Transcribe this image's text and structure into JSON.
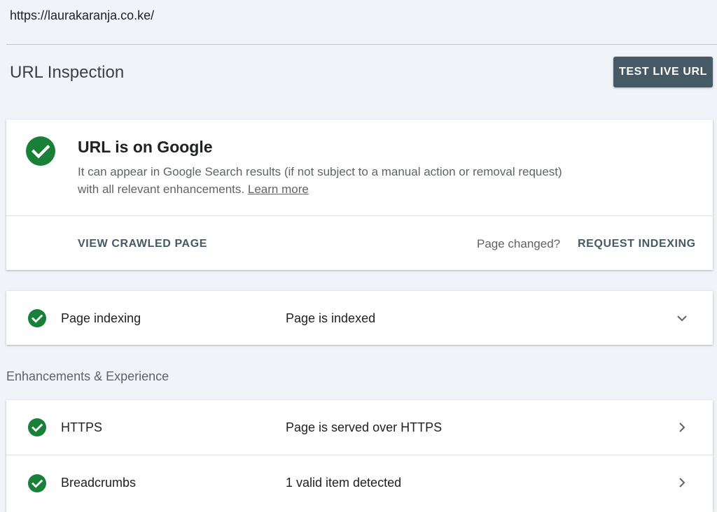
{
  "browser": {
    "url": "https://laurakaranja.co.ke/"
  },
  "header": {
    "title": "URL Inspection",
    "test_live_url_label": "TEST LIVE URL"
  },
  "status": {
    "title": "URL is on Google",
    "description": "It can appear in Google Search results (if not subject to a manual action or removal request) with all relevant enhancements.",
    "learn_more": "Learn more",
    "view_crawled_page": "VIEW CRAWLED PAGE",
    "page_changed": "Page changed?",
    "request_indexing": "REQUEST INDEXING",
    "check_color": "#188038"
  },
  "indexing": {
    "label": "Page indexing",
    "value": "Page is indexed"
  },
  "enhancements": {
    "heading": "Enhancements & Experience",
    "rows": [
      {
        "label": "HTTPS",
        "value": "Page is served over HTTPS"
      },
      {
        "label": "Breadcrumbs",
        "value": "1 valid item detected"
      }
    ]
  },
  "icons": {
    "status": "check-circle-icon",
    "expand": "chevron-down-icon",
    "navigate": "chevron-right-icon"
  }
}
